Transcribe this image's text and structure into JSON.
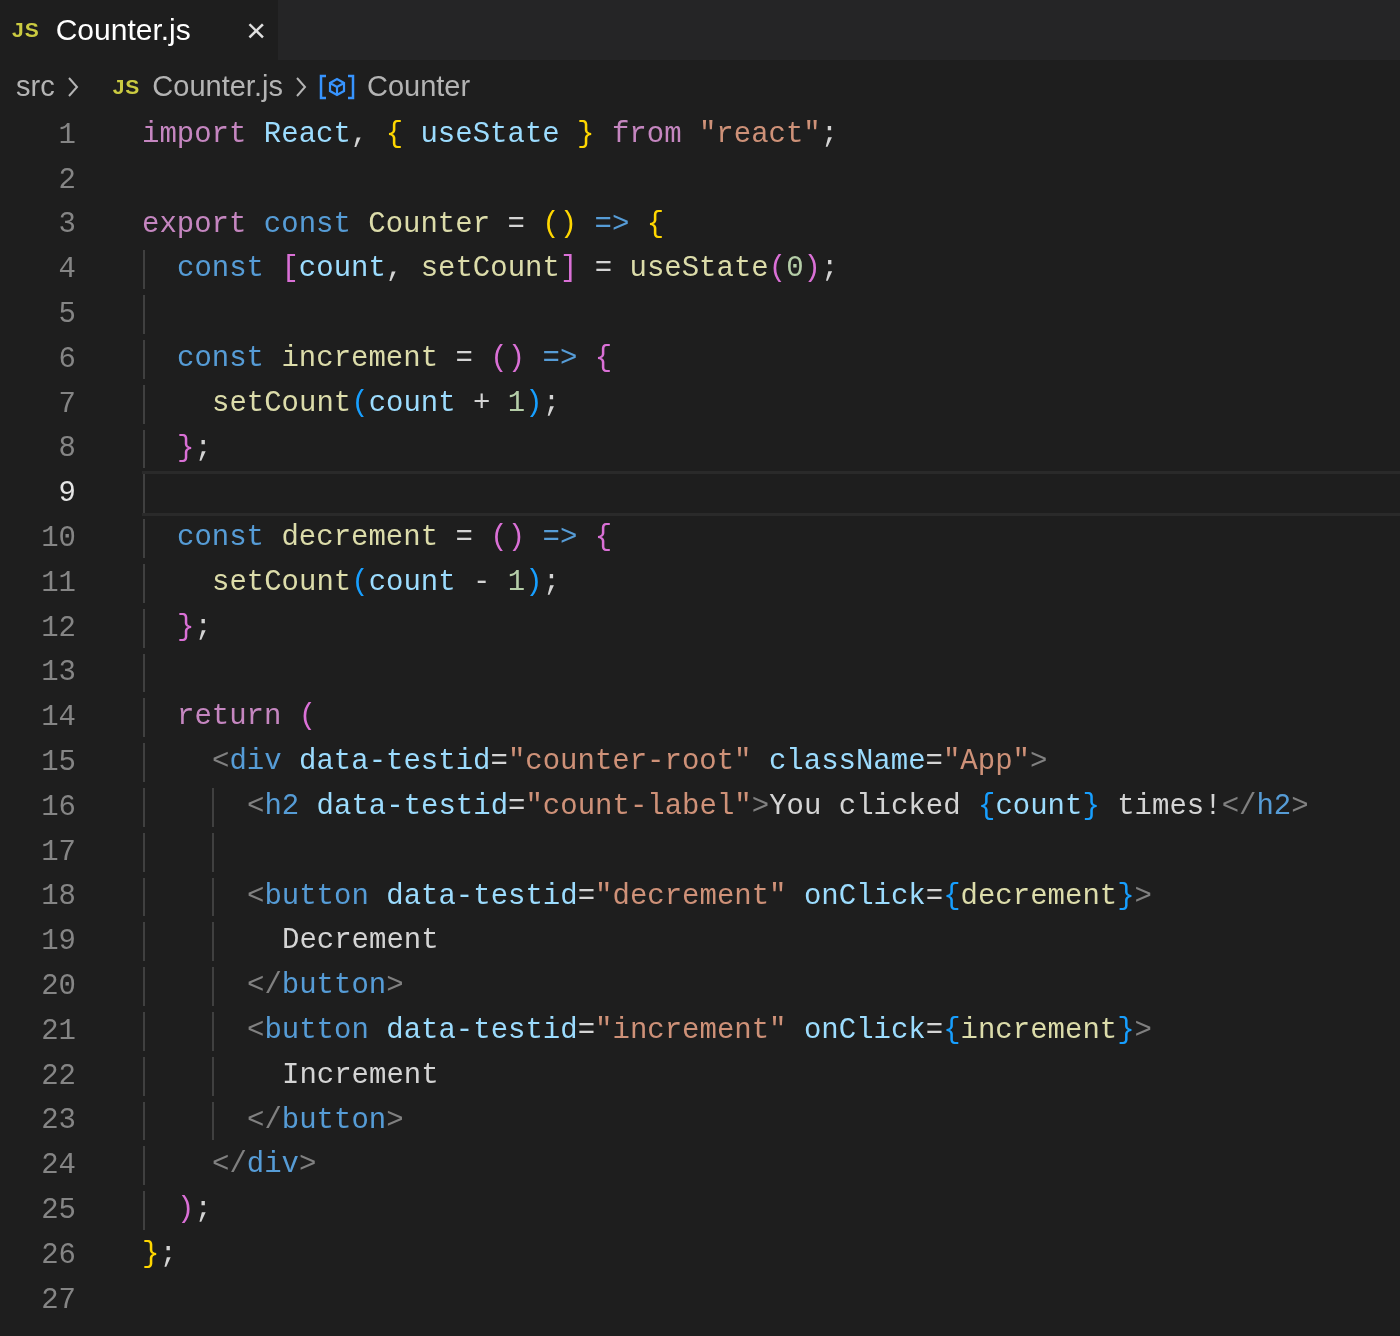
{
  "tab": {
    "icon": "JS",
    "title": "Counter.js",
    "close": "×",
    "selected": true
  },
  "breadcrumb": [
    {
      "kind": "folder",
      "label": "src"
    },
    {
      "kind": "file",
      "icon": "JS",
      "label": "Counter.js"
    },
    {
      "kind": "symbol",
      "label": "Counter"
    }
  ],
  "editor": {
    "lines": [
      {
        "number": "1",
        "current": false,
        "tokens": [
          {
            "kind": "kw",
            "text": "import"
          },
          {
            "kind": "var",
            "text": " React"
          },
          {
            "kind": "op",
            "text": ","
          },
          {
            "kind": "gold",
            "text": " {"
          },
          {
            "kind": "var",
            "text": " useState"
          },
          {
            "kind": "gold",
            "text": " }"
          },
          {
            "kind": "kw",
            "text": " from"
          },
          {
            "kind": "str",
            "text": " \"react\""
          },
          {
            "kind": "op",
            "text": ";"
          }
        ]
      },
      {
        "number": "2",
        "current": false
      },
      {
        "number": "3",
        "current": false,
        "tokens": [
          {
            "kind": "kw",
            "text": "export"
          },
          {
            "kind": "decl",
            "text": " const"
          },
          {
            "kind": "fn",
            "text": " Counter"
          },
          {
            "kind": "op",
            "text": " ="
          },
          {
            "kind": "gold",
            "text": " ()"
          },
          {
            "kind": "decl",
            "text": " =>"
          },
          {
            "kind": "gold",
            "text": " {"
          }
        ],
        "children": [
          {
            "number": "4",
            "current": false,
            "tokens": [
              {
                "kind": "decl",
                "text": "const"
              },
              {
                "kind": "pink",
                "text": " ["
              },
              {
                "kind": "var",
                "text": "count"
              },
              {
                "kind": "op",
                "text": ","
              },
              {
                "kind": "fn",
                "text": " setCount"
              },
              {
                "kind": "pink",
                "text": "]"
              },
              {
                "kind": "op",
                "text": " ="
              },
              {
                "kind": "fn",
                "text": " useState"
              },
              {
                "kind": "pink",
                "text": "("
              },
              {
                "kind": "num",
                "text": "0"
              },
              {
                "kind": "pink",
                "text": ")"
              },
              {
                "kind": "op",
                "text": ";"
              }
            ]
          },
          {
            "number": "5",
            "current": false
          },
          {
            "number": "6",
            "current": false,
            "tokens": [
              {
                "kind": "decl",
                "text": "const"
              },
              {
                "kind": "fn",
                "text": " increment"
              },
              {
                "kind": "op",
                "text": " ="
              },
              {
                "kind": "pink",
                "text": " ()"
              },
              {
                "kind": "decl",
                "text": " =>"
              },
              {
                "kind": "pink",
                "text": " {"
              }
            ],
            "children": [
              {
                "number": "7",
                "current": false,
                "tokens": [
                  {
                    "kind": "fn",
                    "text": "setCount"
                  },
                  {
                    "kind": "blue",
                    "text": "("
                  },
                  {
                    "kind": "var",
                    "text": "count"
                  },
                  {
                    "kind": "op",
                    "text": " +"
                  },
                  {
                    "kind": "num",
                    "text": " 1"
                  },
                  {
                    "kind": "blue",
                    "text": ")"
                  },
                  {
                    "kind": "op",
                    "text": ";"
                  }
                ]
              }
            ]
          },
          {
            "number": "8",
            "current": false,
            "tokens": [
              {
                "kind": "pink",
                "text": "}"
              },
              {
                "kind": "op",
                "text": ";"
              }
            ]
          },
          {
            "number": "9",
            "current": true
          },
          {
            "number": "10",
            "current": false,
            "tokens": [
              {
                "kind": "decl",
                "text": "const"
              },
              {
                "kind": "fn",
                "text": " decrement"
              },
              {
                "kind": "op",
                "text": " ="
              },
              {
                "kind": "pink",
                "text": " ()"
              },
              {
                "kind": "decl",
                "text": " =>"
              },
              {
                "kind": "pink",
                "text": " {"
              }
            ],
            "children": [
              {
                "number": "11",
                "current": false,
                "tokens": [
                  {
                    "kind": "fn",
                    "text": "setCount"
                  },
                  {
                    "kind": "blue",
                    "text": "("
                  },
                  {
                    "kind": "var",
                    "text": "count"
                  },
                  {
                    "kind": "op",
                    "text": " -"
                  },
                  {
                    "kind": "num",
                    "text": " 1"
                  },
                  {
                    "kind": "blue",
                    "text": ")"
                  },
                  {
                    "kind": "op",
                    "text": ";"
                  }
                ]
              }
            ]
          },
          {
            "number": "12",
            "current": false,
            "tokens": [
              {
                "kind": "pink",
                "text": "}"
              },
              {
                "kind": "op",
                "text": ";"
              }
            ]
          },
          {
            "number": "13",
            "current": false
          },
          {
            "number": "14",
            "current": false,
            "tokens": [
              {
                "kind": "kw",
                "text": "return"
              },
              {
                "kind": "pink",
                "text": " ("
              }
            ],
            "children": [
              {
                "number": "15",
                "current": false,
                "tokens": [
                  {
                    "kind": "tagp",
                    "text": "<"
                  },
                  {
                    "kind": "tag",
                    "text": "div"
                  },
                  {
                    "kind": "attr",
                    "text": " data-testid"
                  },
                  {
                    "kind": "op",
                    "text": "="
                  },
                  {
                    "kind": "str",
                    "text": "\"counter-root\""
                  },
                  {
                    "kind": "attr",
                    "text": " className"
                  },
                  {
                    "kind": "op",
                    "text": "="
                  },
                  {
                    "kind": "str",
                    "text": "\"App\""
                  },
                  {
                    "kind": "tagp",
                    "text": ">"
                  }
                ],
                "children": [
                  {
                    "number": "16",
                    "current": false,
                    "tokens": [
                      {
                        "kind": "tagp",
                        "text": "<"
                      },
                      {
                        "kind": "tag",
                        "text": "h2"
                      },
                      {
                        "kind": "attr",
                        "text": " data-testid"
                      },
                      {
                        "kind": "op",
                        "text": "="
                      },
                      {
                        "kind": "str",
                        "text": "\"count-label\""
                      },
                      {
                        "kind": "tagp",
                        "text": ">"
                      },
                      {
                        "kind": "text",
                        "text": "You clicked"
                      },
                      {
                        "kind": "blue",
                        "text": " {"
                      },
                      {
                        "kind": "var",
                        "text": "count"
                      },
                      {
                        "kind": "blue",
                        "text": "}"
                      },
                      {
                        "kind": "text",
                        "text": " times!"
                      },
                      {
                        "kind": "tagp",
                        "text": "</"
                      },
                      {
                        "kind": "tag",
                        "text": "h2"
                      },
                      {
                        "kind": "tagp",
                        "text": ">"
                      }
                    ]
                  },
                  {
                    "number": "17",
                    "current": false
                  },
                  {
                    "number": "18",
                    "current": false,
                    "tokens": [
                      {
                        "kind": "tagp",
                        "text": "<"
                      },
                      {
                        "kind": "tag",
                        "text": "button"
                      },
                      {
                        "kind": "attr",
                        "text": " data-testid"
                      },
                      {
                        "kind": "op",
                        "text": "="
                      },
                      {
                        "kind": "str",
                        "text": "\"decrement\""
                      },
                      {
                        "kind": "attr",
                        "text": " onClick"
                      },
                      {
                        "kind": "op",
                        "text": "="
                      },
                      {
                        "kind": "blue",
                        "text": "{"
                      },
                      {
                        "kind": "fn",
                        "text": "decrement"
                      },
                      {
                        "kind": "blue",
                        "text": "}"
                      },
                      {
                        "kind": "tagp",
                        "text": ">"
                      }
                    ],
                    "children": [
                      {
                        "number": "19",
                        "current": false,
                        "tokens": [
                          {
                            "kind": "text",
                            "text": "Decrement"
                          }
                        ]
                      }
                    ]
                  },
                  {
                    "number": "20",
                    "current": false,
                    "tokens": [
                      {
                        "kind": "tagp",
                        "text": "</"
                      },
                      {
                        "kind": "tag",
                        "text": "button"
                      },
                      {
                        "kind": "tagp",
                        "text": ">"
                      }
                    ]
                  },
                  {
                    "number": "21",
                    "current": false,
                    "tokens": [
                      {
                        "kind": "tagp",
                        "text": "<"
                      },
                      {
                        "kind": "tag",
                        "text": "button"
                      },
                      {
                        "kind": "attr",
                        "text": " data-testid"
                      },
                      {
                        "kind": "op",
                        "text": "="
                      },
                      {
                        "kind": "str",
                        "text": "\"increment\""
                      },
                      {
                        "kind": "attr",
                        "text": " onClick"
                      },
                      {
                        "kind": "op",
                        "text": "="
                      },
                      {
                        "kind": "blue",
                        "text": "{"
                      },
                      {
                        "kind": "fn",
                        "text": "increment"
                      },
                      {
                        "kind": "blue",
                        "text": "}"
                      },
                      {
                        "kind": "tagp",
                        "text": ">"
                      }
                    ],
                    "children": [
                      {
                        "number": "22",
                        "current": false,
                        "tokens": [
                          {
                            "kind": "text",
                            "text": "Increment"
                          }
                        ]
                      }
                    ]
                  },
                  {
                    "number": "23",
                    "current": false,
                    "tokens": [
                      {
                        "kind": "tagp",
                        "text": "</"
                      },
                      {
                        "kind": "tag",
                        "text": "button"
                      },
                      {
                        "kind": "tagp",
                        "text": ">"
                      }
                    ]
                  }
                ]
              },
              {
                "number": "24",
                "current": false,
                "tokens": [
                  {
                    "kind": "tagp",
                    "text": "</"
                  },
                  {
                    "kind": "tag",
                    "text": "div"
                  },
                  {
                    "kind": "tagp",
                    "text": ">"
                  }
                ]
              }
            ]
          },
          {
            "number": "25",
            "current": false,
            "tokens": [
              {
                "kind": "pink",
                "text": ")"
              },
              {
                "kind": "op",
                "text": ";"
              }
            ]
          }
        ]
      },
      {
        "number": "26",
        "current": false,
        "tokens": [
          {
            "kind": "gold",
            "text": "}"
          },
          {
            "kind": "op",
            "text": ";"
          }
        ]
      },
      {
        "number": "27",
        "current": false
      }
    ]
  }
}
